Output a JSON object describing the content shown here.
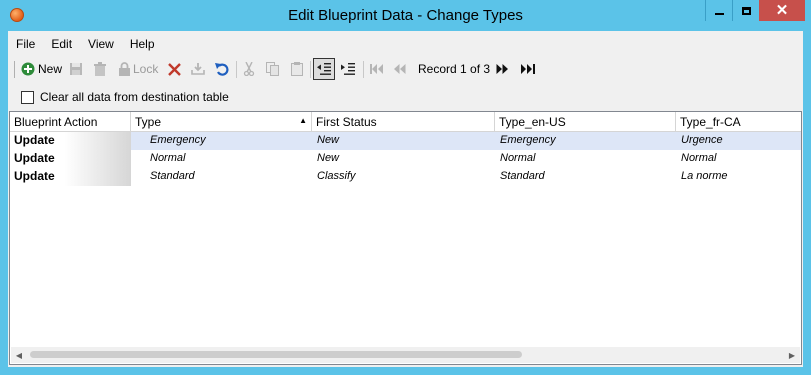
{
  "window": {
    "title": "Edit Blueprint Data - Change Types"
  },
  "menu": [
    "File",
    "Edit",
    "View",
    "Help"
  ],
  "toolbar": {
    "new_label": "New",
    "lock_label": "Lock",
    "record_text": "Record 1 of 3"
  },
  "options": {
    "clear_label": "Clear all data from destination table",
    "clear_checked": false
  },
  "grid": {
    "columns": [
      "Blueprint Action",
      "Type",
      "First Status",
      "Type_en-US",
      "Type_fr-CA"
    ],
    "sorted_column": "Type",
    "rows": [
      [
        "Update",
        "Emergency",
        "New",
        "Emergency",
        "Urgence"
      ],
      [
        "Update",
        "Normal",
        "New",
        "Normal",
        "Normal"
      ],
      [
        "Update",
        "Standard",
        "Classify",
        "Standard",
        "La norme"
      ]
    ]
  },
  "colors": {
    "title_bar": "#5bc3e8",
    "close_button": "#c7504b",
    "selected_row": "#dde6f7",
    "new_icon": "#2e8b3a",
    "delete_icon": "#c0392b",
    "undo_icon": "#1f5fbf"
  }
}
